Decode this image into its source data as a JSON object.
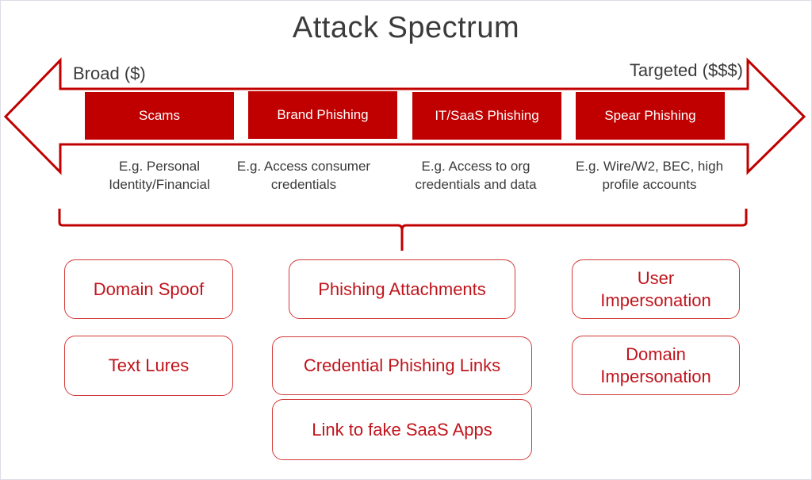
{
  "title": "Attack Spectrum",
  "spectrum": {
    "left_label": "Broad ($)",
    "right_label": "Targeted ($$$)",
    "colors": {
      "accent": "#c00000",
      "outline": "#c00000",
      "technique_text": "#c0141c",
      "text": "#3b3b3b"
    },
    "categories": [
      {
        "label": "Scams",
        "description_line1": "E.g. Personal",
        "description_line2": "Identity/Financial"
      },
      {
        "label": "Brand Phishing",
        "description_line1": "E.g. Access consumer",
        "description_line2": "credentials"
      },
      {
        "label": "IT/SaaS Phishing",
        "description_line1": "E.g. Access to org",
        "description_line2": "credentials and data"
      },
      {
        "label": "Spear Phishing",
        "description_line1": "E.g. Wire/W2, BEC, high",
        "description_line2": "profile accounts"
      }
    ]
  },
  "techniques": {
    "left_column": [
      {
        "label": "Domain Spoof"
      },
      {
        "label": "Text Lures"
      }
    ],
    "middle_column": [
      {
        "label": "Phishing Attachments"
      },
      {
        "label": "Credential Phishing Links"
      },
      {
        "label": "Link to fake SaaS Apps"
      }
    ],
    "right_column": [
      {
        "label_line1": "User",
        "label_line2": "Impersonation"
      },
      {
        "label_line1": "Domain",
        "label_line2": "Impersonation"
      }
    ]
  }
}
